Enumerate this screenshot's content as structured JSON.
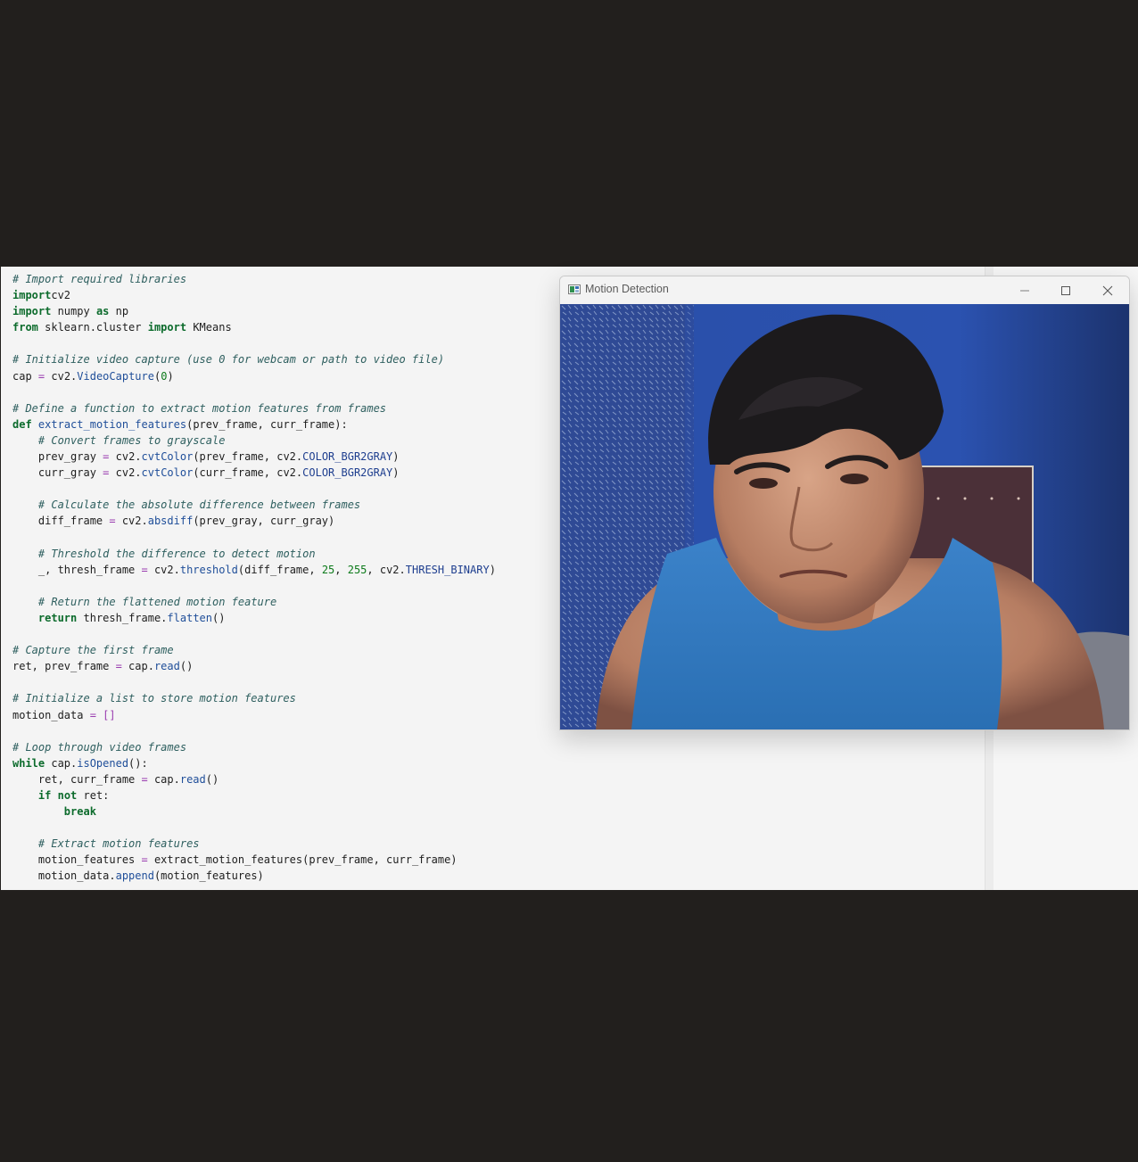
{
  "editor": {
    "lines": [
      [
        [
          "cm",
          "# Import required libraries"
        ]
      ],
      [
        [
          "kw",
          "import"
        ],
        [
          "",
          "cv2"
        ]
      ],
      [
        [
          "kw",
          "import"
        ],
        [
          "",
          " numpy "
        ],
        [
          "kw",
          "as"
        ],
        [
          "",
          " np"
        ]
      ],
      [
        [
          "kw",
          "from"
        ],
        [
          "",
          " sklearn.cluster "
        ],
        [
          "kw",
          "import"
        ],
        [
          "",
          " KMeans"
        ]
      ],
      [],
      [
        [
          "cm",
          "# Initialize video capture (use 0 for webcam or path to video file)"
        ]
      ],
      [
        [
          "",
          "cap "
        ],
        [
          "op",
          "="
        ],
        [
          "",
          " cv2."
        ],
        [
          "fn",
          "VideoCapture"
        ],
        [
          "",
          "("
        ],
        [
          "num",
          "0"
        ],
        [
          "",
          ")"
        ]
      ],
      [],
      [
        [
          "cm",
          "# Define a function to extract motion features from frames"
        ]
      ],
      [
        [
          "kw",
          "def"
        ],
        [
          "",
          " "
        ],
        [
          "fn",
          "extract_motion_features"
        ],
        [
          "",
          "(prev_frame, curr_frame):"
        ]
      ],
      [
        [
          "",
          "    "
        ],
        [
          "cm",
          "# Convert frames to grayscale"
        ]
      ],
      [
        [
          "",
          "    prev_gray "
        ],
        [
          "op",
          "="
        ],
        [
          "",
          " cv2."
        ],
        [
          "fn",
          "cvtColor"
        ],
        [
          "",
          "(prev_frame, cv2."
        ],
        [
          "cst",
          "COLOR_BGR2GRAY"
        ],
        [
          "",
          ")"
        ]
      ],
      [
        [
          "",
          "    curr_gray "
        ],
        [
          "op",
          "="
        ],
        [
          "",
          " cv2."
        ],
        [
          "fn",
          "cvtColor"
        ],
        [
          "",
          "(curr_frame, cv2."
        ],
        [
          "cst",
          "COLOR_BGR2GRAY"
        ],
        [
          "",
          ")"
        ]
      ],
      [],
      [
        [
          "",
          "    "
        ],
        [
          "cm",
          "# Calculate the absolute difference between frames"
        ]
      ],
      [
        [
          "",
          "    diff_frame "
        ],
        [
          "op",
          "="
        ],
        [
          "",
          " cv2."
        ],
        [
          "fn",
          "absdiff"
        ],
        [
          "",
          "(prev_gray, curr_gray)"
        ]
      ],
      [],
      [
        [
          "",
          "    "
        ],
        [
          "cm",
          "# Threshold the difference to detect motion"
        ]
      ],
      [
        [
          "",
          "    _, thresh_frame "
        ],
        [
          "op",
          "="
        ],
        [
          "",
          " cv2."
        ],
        [
          "fn",
          "threshold"
        ],
        [
          "",
          "(diff_frame, "
        ],
        [
          "num",
          "25"
        ],
        [
          "",
          ", "
        ],
        [
          "num",
          "255"
        ],
        [
          "",
          ", cv2."
        ],
        [
          "cst",
          "THRESH_BINARY"
        ],
        [
          "",
          ")"
        ]
      ],
      [],
      [
        [
          "",
          "    "
        ],
        [
          "cm",
          "# Return the flattened motion feature"
        ]
      ],
      [
        [
          "",
          "    "
        ],
        [
          "kw",
          "return"
        ],
        [
          "",
          " thresh_frame."
        ],
        [
          "fn",
          "flatten"
        ],
        [
          "",
          "()"
        ]
      ],
      [],
      [
        [
          "cm",
          "# Capture the first frame"
        ]
      ],
      [
        [
          "",
          "ret, prev_frame "
        ],
        [
          "op",
          "="
        ],
        [
          "",
          " cap."
        ],
        [
          "fn",
          "read"
        ],
        [
          "",
          "()"
        ]
      ],
      [],
      [
        [
          "cm",
          "# Initialize a list to store motion features"
        ]
      ],
      [
        [
          "",
          "motion_data "
        ],
        [
          "op",
          "="
        ],
        [
          "",
          " "
        ],
        [
          "op",
          "[]"
        ]
      ],
      [],
      [
        [
          "cm",
          "# Loop through video frames"
        ]
      ],
      [
        [
          "kw",
          "while"
        ],
        [
          "",
          " cap."
        ],
        [
          "fn",
          "isOpened"
        ],
        [
          "",
          "():"
        ]
      ],
      [
        [
          "",
          "    ret, curr_frame "
        ],
        [
          "op",
          "="
        ],
        [
          "",
          " cap."
        ],
        [
          "fn",
          "read"
        ],
        [
          "",
          "()"
        ]
      ],
      [
        [
          "",
          "    "
        ],
        [
          "kw",
          "if"
        ],
        [
          "",
          " "
        ],
        [
          "kw",
          "not"
        ],
        [
          "",
          " ret:"
        ]
      ],
      [
        [
          "",
          "        "
        ],
        [
          "kw",
          "break"
        ]
      ],
      [],
      [
        [
          "",
          "    "
        ],
        [
          "cm",
          "# Extract motion features"
        ]
      ],
      [
        [
          "",
          "    motion_features "
        ],
        [
          "op",
          "="
        ],
        [
          "",
          " extract_motion_features(prev_frame, curr_frame)"
        ]
      ],
      [
        [
          "",
          "    motion_data."
        ],
        [
          "fn",
          "append"
        ],
        [
          "",
          "(motion_features)"
        ]
      ]
    ]
  },
  "window": {
    "title": "Motion Detection",
    "icons": [
      "app-icon",
      "minimize-icon",
      "maximize-icon",
      "close-icon"
    ]
  },
  "colors": {
    "background": "#221f1d",
    "editor_bg": "#f4f4f4",
    "comment": "#2e5f5f",
    "keyword": "#0c6b2c",
    "function": "#1f4e99",
    "operator": "#9a3db0",
    "number": "#0c7a1a",
    "constant": "#1f3f8f"
  }
}
